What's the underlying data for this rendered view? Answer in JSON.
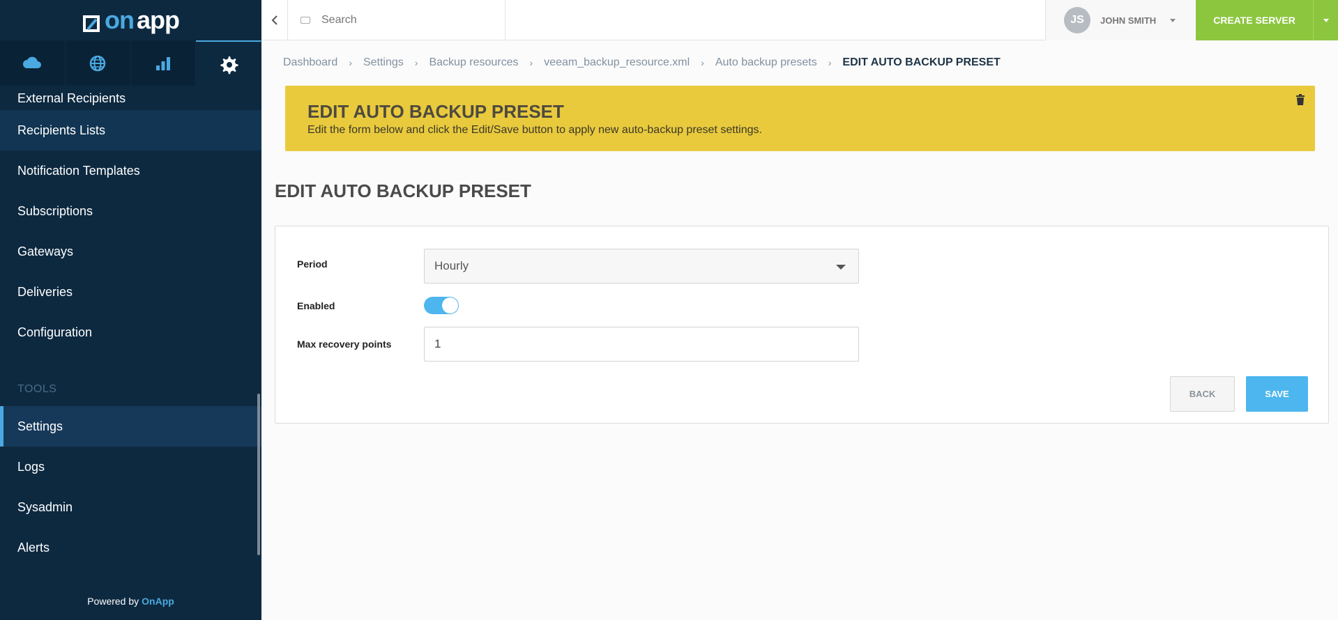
{
  "app": {
    "logo_text_on": "on",
    "logo_text_app": "app"
  },
  "sidebar": {
    "tabs": [
      {
        "icon": "cloud-icon"
      },
      {
        "icon": "globe-icon"
      },
      {
        "icon": "bar-chart-icon"
      },
      {
        "icon": "gear-icon",
        "active": true
      }
    ],
    "items": [
      {
        "label": "External Recipients"
      },
      {
        "label": "Recipients Lists"
      },
      {
        "label": "Notification Templates"
      },
      {
        "label": "Subscriptions"
      },
      {
        "label": "Gateways"
      },
      {
        "label": "Deliveries"
      },
      {
        "label": "Configuration"
      }
    ],
    "tools_section": "TOOLS",
    "tools_items": [
      {
        "label": "Settings",
        "active": true
      },
      {
        "label": "Logs"
      },
      {
        "label": "Sysadmin"
      },
      {
        "label": "Alerts"
      }
    ],
    "powered_by": "Powered by",
    "powered_brand": "OnApp"
  },
  "topbar": {
    "search_placeholder": "Search",
    "user_initials": "JS",
    "user_name": "JOHN SMITH",
    "create_label": "CREATE SERVER"
  },
  "breadcrumb": [
    "Dashboard",
    "Settings",
    "Backup resources",
    "veeam_backup_resource.xml",
    "Auto backup presets",
    "EDIT AUTO BACKUP PRESET"
  ],
  "banner": {
    "title": "EDIT AUTO BACKUP PRESET",
    "text": "Edit the form below and click the Edit/Save button to apply new auto-backup preset settings."
  },
  "page_title": "EDIT AUTO BACKUP PRESET",
  "form": {
    "period_label": "Period",
    "period_value": "Hourly",
    "enabled_label": "Enabled",
    "enabled": true,
    "max_label": "Max recovery points",
    "max_value": "1",
    "back_label": "BACK",
    "save_label": "SAVE"
  },
  "colors": {
    "sidebar_bg": "#0d2940",
    "accent": "#4aa9e0",
    "create_green": "#8cc63f",
    "banner_yellow": "#e9ca3d",
    "save_blue": "#4db6ee"
  }
}
